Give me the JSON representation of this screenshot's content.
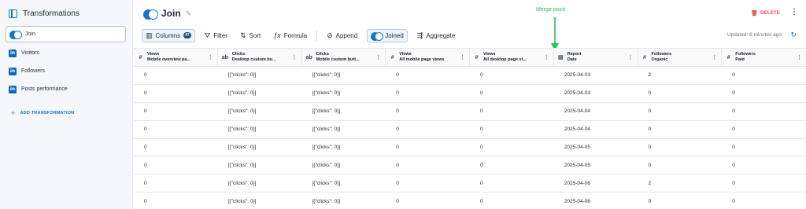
{
  "sidebar": {
    "title": "Transformations",
    "items": [
      {
        "label": "Join",
        "icon": "join-icon",
        "active": true
      },
      {
        "label": "Visitors",
        "icon": "linkedin-icon"
      },
      {
        "label": "Followers",
        "icon": "linkedin-icon"
      },
      {
        "label": "Posts performance",
        "icon": "linkedin-icon"
      }
    ],
    "add_label": "ADD TRANSFORMATION"
  },
  "header": {
    "title": "Join",
    "delete_label": "DELETE",
    "updated": "Updated: 6 minutes ago"
  },
  "toolbar": {
    "columns_label": "Columns",
    "columns_count": "47",
    "filter_label": "Filter",
    "sort_label": "Sort",
    "formula_label": "Formula",
    "append_label": "Append",
    "joined_label": "Joined",
    "aggregate_label": "Aggregate"
  },
  "annotation": {
    "merge_label": "Merge point",
    "color": "#22c55e"
  },
  "table": {
    "columns": [
      {
        "icon": "#",
        "name": "Views",
        "sub": "Mobile overview pa..."
      },
      {
        "icon": "ab",
        "name": "Clicks",
        "sub": "Desktop custom bu..."
      },
      {
        "icon": "ab",
        "name": "Clicks",
        "sub": "Mobile custom butt..."
      },
      {
        "icon": "#",
        "name": "Views",
        "sub": "All mobile page views"
      },
      {
        "icon": "#",
        "name": "Views",
        "sub": "All desktop page vi..."
      },
      {
        "icon": "▤",
        "name": "Report",
        "sub": "Date"
      },
      {
        "icon": "#",
        "name": "Followers",
        "sub": "Organic"
      },
      {
        "icon": "#",
        "name": "Followers",
        "sub": "Paid"
      }
    ],
    "rows": [
      [
        "0",
        "[{\"clicks\": 0}]",
        "[{\"clicks\": 0}]",
        "0",
        "0",
        "2025-04-03",
        "2",
        "0"
      ],
      [
        "0",
        "[{\"clicks\": 0}]",
        "[{\"clicks\": 0}]",
        "0",
        "0",
        "2025-04-03",
        "0",
        "0"
      ],
      [
        "0",
        "[{\"clicks\": 0}]",
        "[{\"clicks\": 0}]",
        "0",
        "0",
        "2025-04-04",
        "0",
        "0"
      ],
      [
        "0",
        "[{\"clicks\": 0}]",
        "[{\"clicks\": 0}]",
        "0",
        "0",
        "2025-04-04",
        "0",
        "0"
      ],
      [
        "0",
        "[{\"clicks\": 0}]",
        "[{\"clicks\": 0}]",
        "0",
        "0",
        "2025-04-05",
        "0",
        "0"
      ],
      [
        "0",
        "[{\"clicks\": 0}]",
        "[{\"clicks\": 0}]",
        "0",
        "0",
        "2025-04-05",
        "0",
        "0"
      ],
      [
        "0",
        "[{\"clicks\": 0}]",
        "[{\"clicks\": 0}]",
        "0",
        "0",
        "2025-04-06",
        "2",
        "0"
      ],
      [
        "0",
        "[{\"clicks\": 0}]",
        "[{\"clicks\": 0}]",
        "0",
        "0",
        "2025-04-06",
        "0",
        "0"
      ]
    ]
  },
  "colors": {
    "accent": "#1677c9",
    "delete": "#e5484d",
    "join_highlight": "#7c3aed"
  }
}
